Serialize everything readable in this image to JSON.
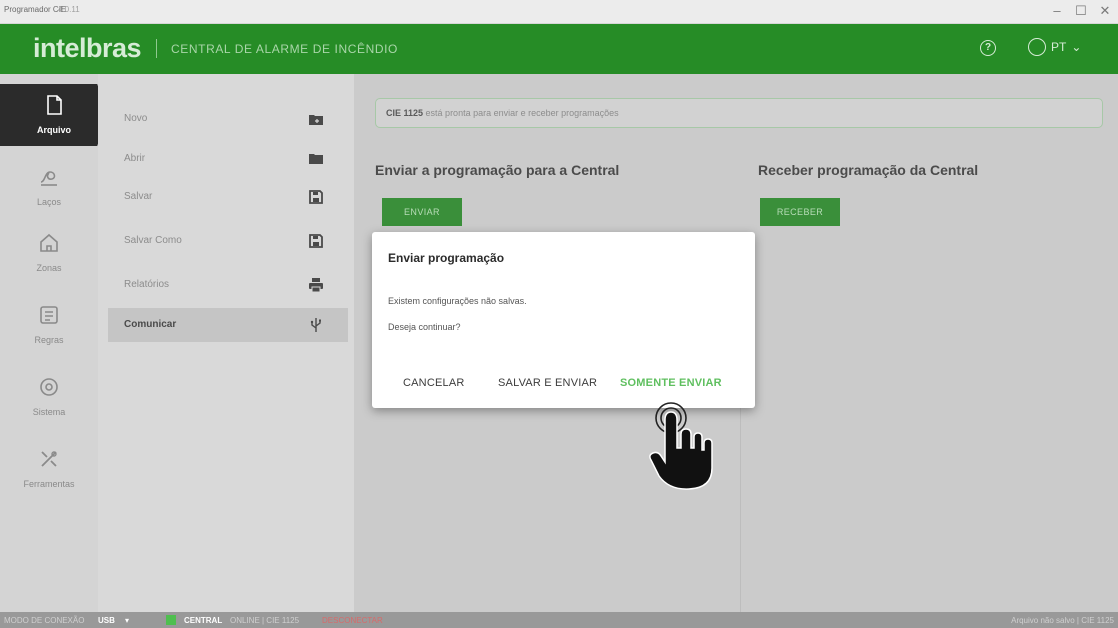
{
  "window": {
    "title": "Programador CIE",
    "version": "4.0.11",
    "minimize": "–",
    "maximize": "☐",
    "close": "✕"
  },
  "header": {
    "logo": "intelbras",
    "divider": "|",
    "subtitle": "CENTRAL DE ALARME DE INCÊNDIO",
    "help_symbol": "?",
    "language": "PT",
    "language_caret": "⌄"
  },
  "rail": {
    "items": [
      {
        "label": "Arquivo",
        "icon": "file-icon"
      },
      {
        "label": "Laços",
        "icon": "loop-icon"
      },
      {
        "label": "Zonas",
        "icon": "home-icon"
      },
      {
        "label": "Regras",
        "icon": "rules-icon"
      },
      {
        "label": "Sistema",
        "icon": "gear-icon"
      },
      {
        "label": "Ferramentas",
        "icon": "tools-icon"
      }
    ]
  },
  "filemenu": {
    "items": [
      {
        "label": "Novo",
        "icon": "new-folder-icon"
      },
      {
        "label": "Abrir",
        "icon": "folder-icon"
      },
      {
        "label": "Salvar",
        "icon": "save-icon"
      },
      {
        "label": "Salvar Como",
        "icon": "save-as-icon"
      },
      {
        "label": "Relatórios",
        "icon": "print-icon"
      },
      {
        "label": "Comunicar",
        "icon": "usb-icon"
      }
    ]
  },
  "main": {
    "status_model": "CIE 1125",
    "status_text": "está pronta para enviar e receber programações",
    "send_title": "Enviar a programação para a Central",
    "send_button": "ENVIAR",
    "receive_title": "Receber programação da Central",
    "receive_button": "RECEBER"
  },
  "dialog": {
    "title": "Enviar programação",
    "line1": "Existem configurações não salvas.",
    "line2": "Deseja continuar?",
    "cancel": "CANCELAR",
    "save_send": "SALVAR E ENVIAR",
    "only_send": "SOMENTE ENVIAR"
  },
  "footer": {
    "mode_label": "MODO DE CONEXÃO",
    "mode_value": "USB",
    "mode_caret": "▾",
    "central_label": "CENTRAL",
    "central_state": "ONLINE | CIE 1125",
    "disconnect": "DESCONECTAR",
    "file_status": "Arquivo não salvo | CIE 1125"
  },
  "colors": {
    "header_green": "#268c26",
    "accent_green": "#5fbf5f",
    "button_green": "#3a8f3a",
    "disconnect_red": "#d86a6a"
  }
}
